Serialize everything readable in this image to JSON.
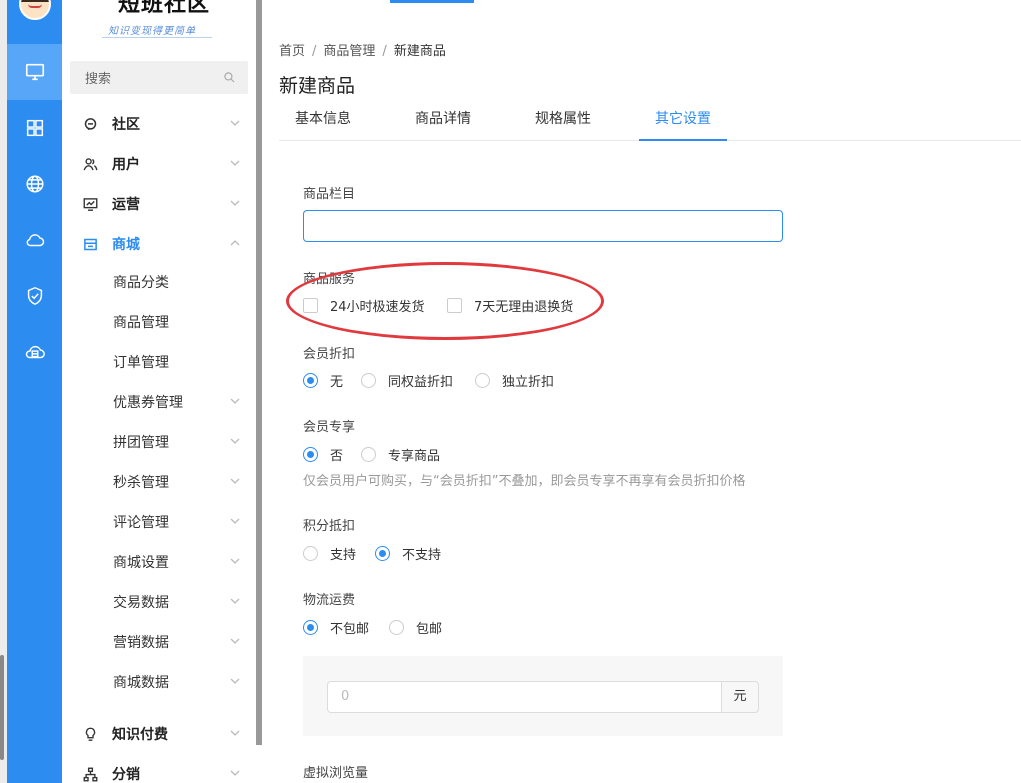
{
  "brand": {
    "title": "短班社区",
    "subtitle": "知识变现得更简单"
  },
  "search": {
    "placeholder": "搜索"
  },
  "menu": {
    "sections": [
      {
        "label": "社区",
        "icon": "chat-icon"
      },
      {
        "label": "用户",
        "icon": "users-icon"
      },
      {
        "label": "运营",
        "icon": "monitor-chart-icon"
      },
      {
        "label": "商城",
        "icon": "store-icon"
      }
    ],
    "mall_items": [
      "商品分类",
      "商品管理",
      "订单管理",
      "优惠券管理",
      "拼团管理",
      "秒杀管理",
      "评论管理",
      "商城设置",
      "交易数据",
      "营销数据",
      "商城数据"
    ],
    "bottom_sections": [
      {
        "label": "知识付费",
        "icon": "lightbulb-icon"
      },
      {
        "label": "分销",
        "icon": "hierarchy-icon"
      }
    ]
  },
  "breadcrumb": {
    "home": "首页",
    "parent": "商品管理",
    "current": "新建商品",
    "separator": "/"
  },
  "page": {
    "title": "新建商品"
  },
  "tabs": [
    "基本信息",
    "商品详情",
    "规格属性",
    "其它设置"
  ],
  "form": {
    "column": {
      "label": "商品栏目",
      "value": ""
    },
    "services": {
      "label": "商品服务",
      "options": [
        "24小时极速发货",
        "7天无理由退换货"
      ]
    },
    "member_discount": {
      "label": "会员折扣",
      "options": [
        "无",
        "同权益折扣",
        "独立折扣"
      ],
      "selected": "无"
    },
    "member_exclusive": {
      "label": "会员专享",
      "options": [
        "否",
        "专享商品"
      ],
      "selected": "否",
      "hint": "仅会员用户可购买，与“会员折扣”不叠加，即会员专享不再享有会员折扣价格"
    },
    "points": {
      "label": "积分抵扣",
      "options": [
        "支持",
        "不支持"
      ],
      "selected": "不支持"
    },
    "shipping": {
      "label": "物流运费",
      "options": [
        "不包邮",
        "包邮"
      ],
      "selected": "不包邮",
      "placeholder": "0",
      "unit": "元"
    },
    "virtual_views": {
      "label": "虚拟浏览量"
    }
  },
  "colors": {
    "accent": "#2d8cf0",
    "annotation": "#e0393e"
  }
}
